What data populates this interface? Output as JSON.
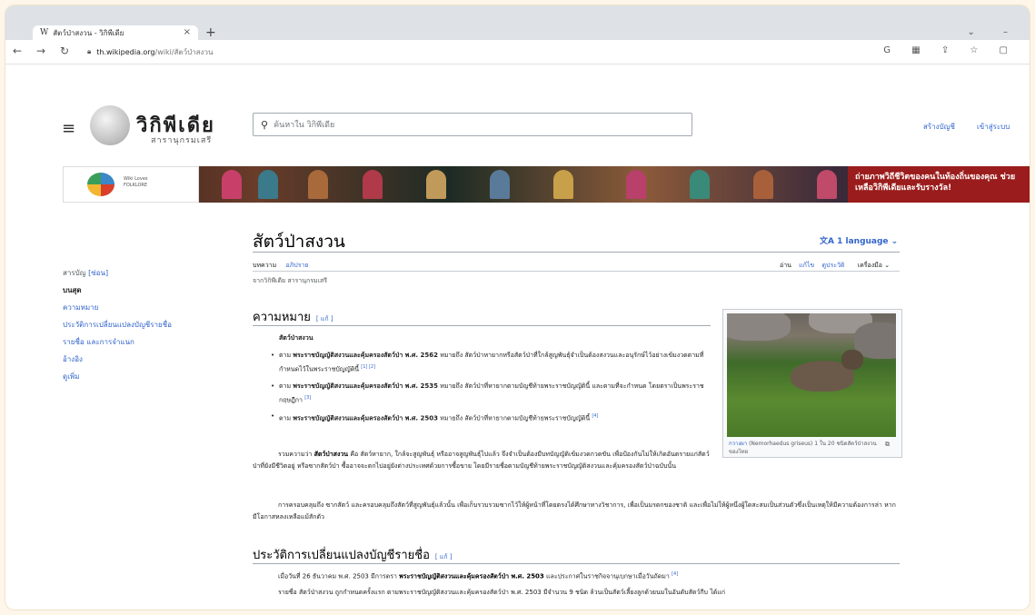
{
  "browser": {
    "tab_title": "สัตว์ป่าสงวน - วิกิพีเดีย",
    "tab_icon": "W",
    "url_host": "th.wikipedia.org",
    "url_path": "/wiki/สัตว์ป่าสงวน"
  },
  "header": {
    "logo_title": "วิกิพีเดีย",
    "logo_tagline": "สารานุกรมเสรี",
    "search_placeholder": "ค้นหาใน วิกิพีเดีย",
    "create_account": "สร้างบัญชี",
    "login": "เข้าสู่ระบบ"
  },
  "banner": {
    "logo_line1": "Wiki Loves",
    "logo_line2": "FOLKLORE",
    "cta": "ถ่ายภาพวิถีชีวิตของคนในท้องถิ่นของคุณ ช่วยเหลือวิกิพีเดียและรับรางวัล!"
  },
  "toc": {
    "title": "สารบัญ",
    "hide": "[ซ่อน]",
    "top": "บนสุด",
    "items": [
      "ความหมาย",
      "ประวัติการเปลี่ยนแปลงบัญชีรายชื่อ",
      "รายชื่อ และการจำแนก",
      "อ้างอิง",
      "ดูเพิ่ม"
    ]
  },
  "article": {
    "title": "สัตว์ป่าสงวน",
    "language_button": "1 language",
    "tab_article": "บทความ",
    "tab_talk": "อภิปราย",
    "tab_read": "อ่าน",
    "tab_edit": "แก้ไข",
    "tab_history": "ดูประวัติ",
    "tab_tools": "เครื่องมือ",
    "tagline": "จากวิกิพีเดีย สารานุกรมเสรี",
    "edit_link": "[ แก้ ]",
    "sec1_title": "ความหมาย",
    "def_term": "สัตว์ป่าสงวน",
    "b1_pre": "ตาม ",
    "b1_law": "พระราชบัญญัติสงวนและคุ้มครองสัตว์ป่า พ.ศ. 2562",
    "b1_text": " หมายถึง สัตว์ป่าหายากหรือสัตว์ป่าที่ใกล้สูญพันธุ์จำเป็นต้องสงวนและอนุรักษ์ไว้อย่างเข้มงวดตามที่กำหนดไว้ในพระราชบัญญัตินี้",
    "b1_ref": "[1] [2]",
    "b2_pre": "ตาม ",
    "b2_law": "พระราชบัญญัติสงวนและคุ้มครองสัตว์ป่า พ.ศ. 2535",
    "b2_text": " หมายถึง สัตว์ป่าที่หายากตามบัญชีท้ายพระราชบัญญัตินี้ และตามที่จะกำหนด โดยตราเป็นพระราชกฤษฎีกา",
    "b2_ref": "[3]",
    "b3_pre": "ตาม ",
    "b3_law": "พระราชบัญญัติสงวนและคุ้มครองสัตว์ป่า พ.ศ. 2503",
    "b3_text": " หมายถึง สัตว์ป่าที่หายากตามบัญชีท้ายพระราชบัญญัตินี้",
    "b3_ref": "[4]",
    "para1_pre": "รวมความว่า ",
    "para1_bold": "สัตว์ป่าสงวน",
    "para1_text": " คือ สัตว์หายาก, ใกล้จะสูญพันธุ์ หรืออาจสูญพันธุ์ไปแล้ว จึงจำเป็นต้องมีบทบัญญัติเข้มงวดกวดขัน เพื่อป้องกันไม่ให้เกิดอันตรายแก่สัตว์ป่าที่ยังมีชีวิตอยู่ หรือซากสัตว์ป่า ซื้ออาจจะตกไปอยู่ยังต่างประเทศด้วยการซื้อขาย โดยมีรายชื่อตามบัญชีท้ายพระราชบัญญัติสงวนและคุ้มครองสัตว์ป่าฉบับนั้น",
    "para2": "การครอบคลุมถึง ซากสัตว์ และครอบคลุมถึงสัตว์ที่สูญพันธุ์แล้วนั้น เพื่อเก็บรวบรวมซากไว้ให้ผู้หน้าที่โดยตรงได้ศึกษาทางวิชาการ, เพื่อเป็นมรดกของชาติ และเพื่อไม่ให้ผู้หนึ่งผู้ใดสะสมเป็นส่วนตัวซึ่งเป็นเหตุให้มีความต้องการล่า หากมีโอกาสหลงเหลือแม้สักตัว",
    "sec2_title": "ประวัติการเปลี่ยนแปลงบัญชีรายชื่อ",
    "para3_pre": "เมื่อวันที่ 26 ธันวาคม พ.ศ. 2503 มีการตรา ",
    "para3_bold": "พระราชบัญญัติสงวนและคุ้มครองสัตว์ป่า พ.ศ. 2503",
    "para3_text": " และประกาศในราชกิจจานุเบกษาเมื่อวันถัดมา",
    "para3_ref": "[4]",
    "para4": "รายชื่อ สัตว์ป่าสงวน ถูกกำหนดครั้งแรก ตามพระราชบัญญัติสงวนและคุ้มครองสัตว์ป่า พ.ศ. 2503 มีจำนวน 9 ชนิด ล้วนเป็นสัตว์เลี้ยงลูกด้วยนมในอันดับสัตว์กีบ ได้แก่"
  },
  "infobox": {
    "caption_link": "กวางผา",
    "caption_text": " (Nemorhaedus griseus) 1 ใน 20 ชนิดสัตว์ป่าสงวนของไทย"
  }
}
